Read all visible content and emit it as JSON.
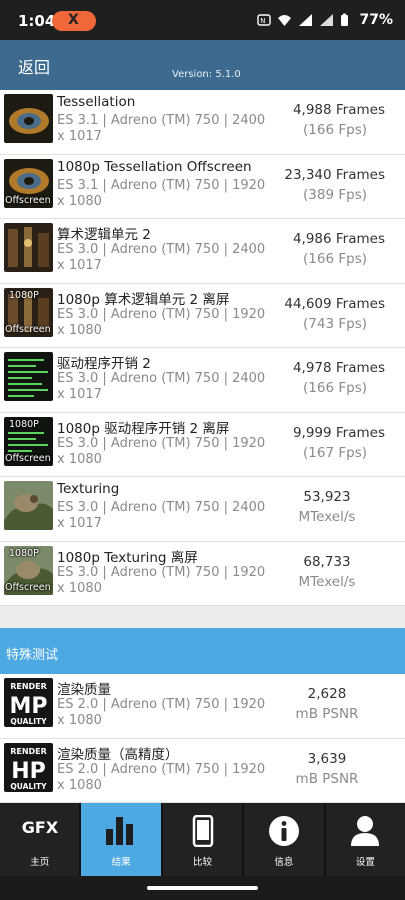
{
  "status_bar": {
    "time": "1:04",
    "notif_badge": "X",
    "icons": [
      "nfc",
      "wifi",
      "signal",
      "battery"
    ],
    "battery": "77%"
  },
  "header": {
    "back_label": "返回",
    "version": "Version: 5.1.0"
  },
  "tests": [
    {
      "name": "Tessellation",
      "detail": "ES 3.1 | Adreno (TM) 750 | 2400 x 1017",
      "score": "4,988 Frames",
      "sub": "(166 Fps)",
      "thumb_top": "",
      "thumb_bottom": ""
    },
    {
      "name": "1080p Tessellation Offscreen",
      "detail": "ES 3.1 | Adreno (TM) 750 | 1920 x 1080",
      "score": "23,340 Frames",
      "sub": "(389 Fps)",
      "thumb_top": "",
      "thumb_bottom": "Offscreen"
    },
    {
      "name": "算术逻辑单元 2",
      "detail": "ES 3.0 | Adreno (TM) 750 | 2400 x 1017",
      "score": "4,986 Frames",
      "sub": "(166 Fps)",
      "thumb_top": "",
      "thumb_bottom": ""
    },
    {
      "name": "1080p 算术逻辑单元 2 离屏",
      "detail": "ES 3.0 | Adreno (TM) 750 | 1920 x 1080",
      "score": "44,609 Frames",
      "sub": "(743 Fps)",
      "thumb_top": "1080P",
      "thumb_bottom": "Offscreen"
    },
    {
      "name": "驱动程序开销 2",
      "detail": "ES 3.0 | Adreno (TM) 750 | 2400 x 1017",
      "score": "4,978 Frames",
      "sub": "(166 Fps)",
      "thumb_top": "",
      "thumb_bottom": ""
    },
    {
      "name": "1080p 驱动程序开销 2 离屏",
      "detail": "ES 3.0 | Adreno (TM) 750 | 1920 x 1080",
      "score": "9,999 Frames",
      "sub": "(167 Fps)",
      "thumb_top": "1080P",
      "thumb_bottom": "Offscreen"
    },
    {
      "name": "Texturing",
      "detail": "ES 3.0 | Adreno (TM) 750 | 2400 x 1017",
      "score": "53,923",
      "sub": "MTexel/s",
      "thumb_top": "",
      "thumb_bottom": ""
    },
    {
      "name": "1080p Texturing 离屏",
      "detail": "ES 3.0 | Adreno (TM) 750 | 1920 x 1080",
      "score": "68,733",
      "sub": "MTexel/s",
      "thumb_top": "1080P",
      "thumb_bottom": "Offscreen"
    }
  ],
  "special_section": {
    "title": "特殊测试"
  },
  "special_tests": [
    {
      "name": "渲染质量",
      "detail": "ES 2.0 | Adreno (TM) 750 | 1920 x 1080",
      "score": "2,628",
      "sub": "mB PSNR",
      "badge_top": "RENDER",
      "badge_mid": "MP",
      "badge_bottom": "QUALITY"
    },
    {
      "name": "渲染质量（高精度）",
      "detail": "ES 2.0 | Adreno (TM) 750 | 1920 x 1080",
      "score": "3,639",
      "sub": "mB PSNR",
      "badge_top": "RENDER",
      "badge_mid": "HP",
      "badge_bottom": "QUALITY"
    }
  ],
  "bottom_nav": [
    {
      "label": "主页",
      "icon": "gfx-logo-icon",
      "logo_text": "GFX",
      "active": false
    },
    {
      "label": "结果",
      "icon": "bar-chart-icon",
      "active": true
    },
    {
      "label": "比较",
      "icon": "phone-icon",
      "active": false
    },
    {
      "label": "信息",
      "icon": "info-icon",
      "active": false
    },
    {
      "label": "设置",
      "icon": "user-icon",
      "active": false
    }
  ],
  "colors": {
    "header": "#3d6a8f",
    "accent": "#4ea9e2",
    "status_pill": "#f0683a"
  }
}
